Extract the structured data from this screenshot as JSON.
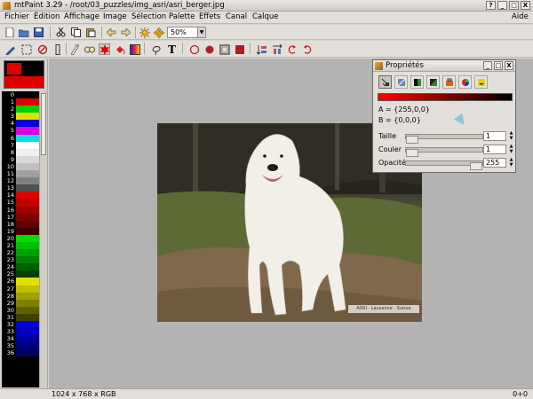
{
  "window": {
    "title": "mtPaint 3.29 - /root/03_puzzles/img_asri/asri_berger.jpg",
    "controls": [
      "?",
      "_",
      "□",
      "X"
    ]
  },
  "menubar": {
    "items": [
      "Fichier",
      "Édition",
      "Affichage",
      "Image",
      "Sélection",
      "Palette",
      "Effets",
      "Canal",
      "Calque"
    ],
    "help": "Aide"
  },
  "toolbar": {
    "zoom": "50%"
  },
  "palette": {
    "entries": [
      {
        "i": "0",
        "c": "#000000"
      },
      {
        "i": "1",
        "c": "#e00000"
      },
      {
        "i": "2",
        "c": "#00d000"
      },
      {
        "i": "3",
        "c": "#e0e000"
      },
      {
        "i": "4",
        "c": "#0000e0"
      },
      {
        "i": "5",
        "c": "#e000e0"
      },
      {
        "i": "6",
        "c": "#00e0e0"
      },
      {
        "i": "7",
        "c": "#ffffff"
      },
      {
        "i": "8",
        "c": "#f0f0f0"
      },
      {
        "i": "9",
        "c": "#d8d8d8"
      },
      {
        "i": "10",
        "c": "#c0c0c0"
      },
      {
        "i": "11",
        "c": "#a0a0a0"
      },
      {
        "i": "12",
        "c": "#808080"
      },
      {
        "i": "13",
        "c": "#505050"
      },
      {
        "i": "14",
        "c": "#e00000"
      },
      {
        "i": "15",
        "c": "#c00000"
      },
      {
        "i": "16",
        "c": "#a00000"
      },
      {
        "i": "17",
        "c": "#800000"
      },
      {
        "i": "18",
        "c": "#600000"
      },
      {
        "i": "19",
        "c": "#400000"
      },
      {
        "i": "20",
        "c": "#00e000"
      },
      {
        "i": "21",
        "c": "#00c000"
      },
      {
        "i": "22",
        "c": "#00a000"
      },
      {
        "i": "23",
        "c": "#008000"
      },
      {
        "i": "24",
        "c": "#006000"
      },
      {
        "i": "25",
        "c": "#004000"
      },
      {
        "i": "26",
        "c": "#e0e000"
      },
      {
        "i": "27",
        "c": "#c0c000"
      },
      {
        "i": "28",
        "c": "#a0a000"
      },
      {
        "i": "29",
        "c": "#808000"
      },
      {
        "i": "30",
        "c": "#606000"
      },
      {
        "i": "31",
        "c": "#404000"
      },
      {
        "i": "32",
        "c": "#0000e0"
      },
      {
        "i": "33",
        "c": "#0000c0"
      },
      {
        "i": "34",
        "c": "#0000a0"
      },
      {
        "i": "35",
        "c": "#000080"
      },
      {
        "i": "36",
        "c": "#000060"
      }
    ]
  },
  "status": {
    "info": "1024 x 768 x RGB",
    "coords": "0+0"
  },
  "image": {
    "watermark": "ASRI · Lausanne · Suisse"
  },
  "properties": {
    "title": "Propriétés",
    "color_a": "A = {255,0,0}",
    "color_b": "B = {0,0,0}",
    "size_label": "Taille",
    "size_value": "1",
    "flow_label": "Couler",
    "flow_value": "1",
    "opacity_label": "Opacité",
    "opacity_value": "255"
  }
}
